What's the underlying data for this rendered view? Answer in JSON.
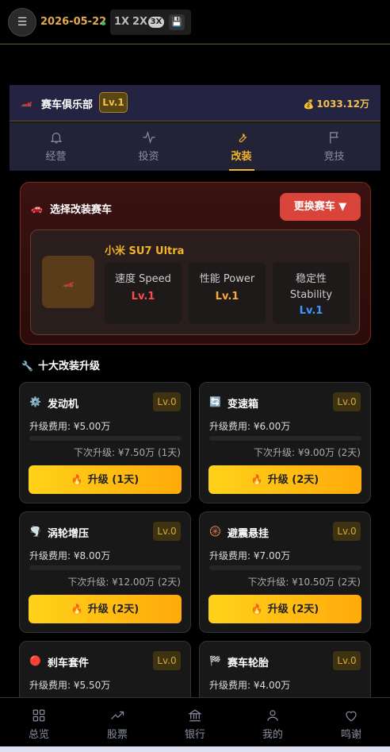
{
  "topbar": {
    "date": "2026-05-22",
    "speeds": [
      "1X",
      "2X",
      "3X"
    ],
    "active_speed": "3X",
    "icons": {
      "menu": "menu-icon",
      "save": "floppy-disk-icon"
    }
  },
  "club": {
    "title": "赛车俱乐部",
    "level": "Lv.1",
    "money": "1033.12万"
  },
  "tabs": [
    {
      "label": "经营",
      "icon": "bell-icon"
    },
    {
      "label": "投资",
      "icon": "activity-icon"
    },
    {
      "label": "改装",
      "icon": "wrench-icon",
      "active": true
    },
    {
      "label": "竞技",
      "icon": "flag-icon"
    }
  ],
  "modify": {
    "title": "选择改装赛车",
    "change_button": "更换赛车 ▼",
    "car_name": "小米 SU7 Ultra",
    "stats": [
      {
        "label": "速度 Speed",
        "value": "Lv.1",
        "color": "#ff4a4a"
      },
      {
        "label": "性能 Power",
        "value": "Lv.1",
        "color": "#ffa83a"
      },
      {
        "label": "稳定性 Stability",
        "value": "Lv.1",
        "color": "#3a9bff"
      }
    ]
  },
  "upgrades": {
    "title": "十大改装升级",
    "items": [
      {
        "icon": "⚙️",
        "icon_name": "gear-icon",
        "name": "发动机",
        "level": "Lv.0",
        "cost": "升级费用: ¥5.00万",
        "next": "下次升级: ¥7.50万 (1天)",
        "button": "升级 (1天)",
        "progress": 0
      },
      {
        "icon": "🔄",
        "icon_name": "cycle-icon",
        "name": "变速箱",
        "level": "Lv.0",
        "cost": "升级费用: ¥6.00万",
        "next": "下次升级: ¥9.00万 (2天)",
        "button": "升级 (2天)",
        "progress": 0
      },
      {
        "icon": "🌪️",
        "icon_name": "tornado-icon",
        "name": "涡轮增压",
        "level": "Lv.0",
        "cost": "升级费用: ¥8.00万",
        "next": "下次升级: ¥12.00万 (2天)",
        "button": "升级 (2天)",
        "progress": 0
      },
      {
        "icon": "🛞",
        "icon_name": "wheel-icon",
        "name": "避震悬挂",
        "level": "Lv.0",
        "cost": "升级费用: ¥7.00万",
        "next": "下次升级: ¥10.50万 (2天)",
        "button": "升级 (2天)",
        "progress": 0
      },
      {
        "icon": "🔴",
        "icon_name": "red-circle-icon",
        "name": "刹车套件",
        "level": "Lv.0",
        "cost": "升级费用: ¥5.50万"
      },
      {
        "icon": "🏁",
        "icon_name": "checkered-flag-icon",
        "name": "赛车轮胎",
        "level": "Lv.0",
        "cost": "升级费用: ¥4.00万"
      }
    ]
  },
  "bottom_nav": [
    {
      "label": "总览",
      "icon": "grid-icon"
    },
    {
      "label": "股票",
      "icon": "trending-up-icon"
    },
    {
      "label": "银行",
      "icon": "bank-icon"
    },
    {
      "label": "我的",
      "icon": "user-icon"
    },
    {
      "label": "鸣谢",
      "icon": "heart-icon"
    }
  ]
}
